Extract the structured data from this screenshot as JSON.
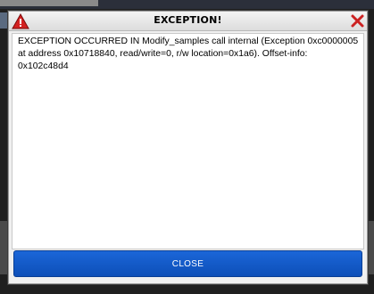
{
  "dialog": {
    "title": "EXCEPTION!",
    "message": "EXCEPTION OCCURRED IN Modify_samples call internal (Exception 0xc0000005 at address 0x10718840, read/write=0, r/w location=0x1a6). Offset-info: 0x102c48d4",
    "close_label": "CLOSE",
    "warning_icon": "warning-triangle-icon",
    "close_icon": "close-x-icon"
  },
  "colors": {
    "button_blue": "#0d4fb8",
    "warning_red": "#d32020",
    "close_red": "#cc2222"
  }
}
